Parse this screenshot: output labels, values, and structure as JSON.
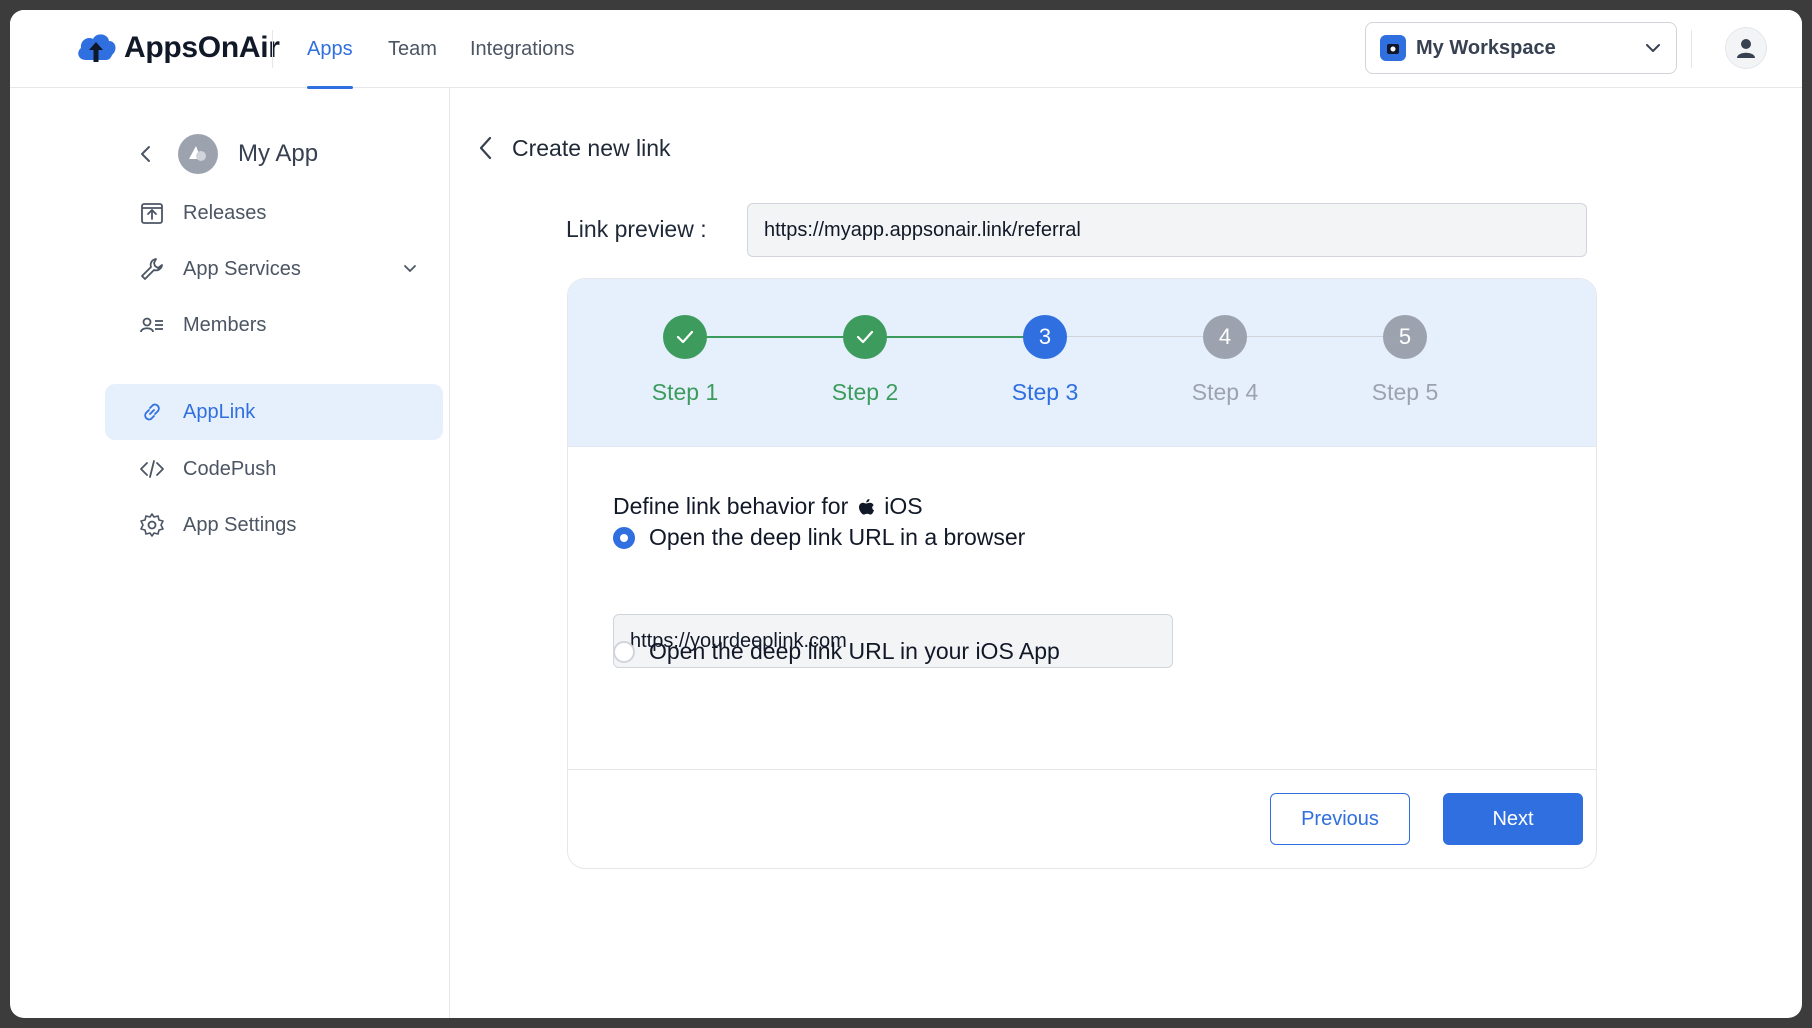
{
  "app": {
    "brand": "AppsOnAir"
  },
  "nav": {
    "tabs": [
      {
        "label": "Apps",
        "active": true
      },
      {
        "label": "Team",
        "active": false
      },
      {
        "label": "Integrations",
        "active": false
      }
    ]
  },
  "workspace": {
    "label": "My Workspace"
  },
  "sidebar": {
    "app_name": "My App",
    "items": [
      {
        "label": "Releases",
        "icon": "upload-box-icon"
      },
      {
        "label": "App Services",
        "icon": "wrench-icon",
        "expandable": true
      },
      {
        "label": "Members",
        "icon": "members-list-icon"
      },
      {
        "label": "AppLink",
        "icon": "link-icon",
        "active": true
      },
      {
        "label": "CodePush",
        "icon": "code-icon"
      },
      {
        "label": "App Settings",
        "icon": "gear-icon"
      }
    ]
  },
  "page": {
    "title": "Create new link",
    "preview_label": "Link preview :",
    "preview_value": "https://myapp.appsonair.link/referral"
  },
  "stepper": {
    "steps": [
      {
        "label": "Step 1",
        "status": "done"
      },
      {
        "label": "Step 2",
        "status": "done"
      },
      {
        "label": "Step 3",
        "status": "current",
        "number": "3"
      },
      {
        "label": "Step 4",
        "status": "pending",
        "number": "4"
      },
      {
        "label": "Step 5",
        "status": "pending",
        "number": "5"
      }
    ],
    "colors": {
      "done": "#3d9c5d",
      "current": "#2f6fdf",
      "pending": "#9ca3af"
    }
  },
  "form": {
    "heading_prefix": "Define link behavior for",
    "platform": "iOS",
    "option_browser": "Open the deep link URL in a browser",
    "option_browser_selected": true,
    "deeplink_value": "https://yourdeeplink.com",
    "option_app": "Open the deep link URL in your iOS App",
    "option_app_selected": false
  },
  "actions": {
    "previous": "Previous",
    "next": "Next"
  }
}
